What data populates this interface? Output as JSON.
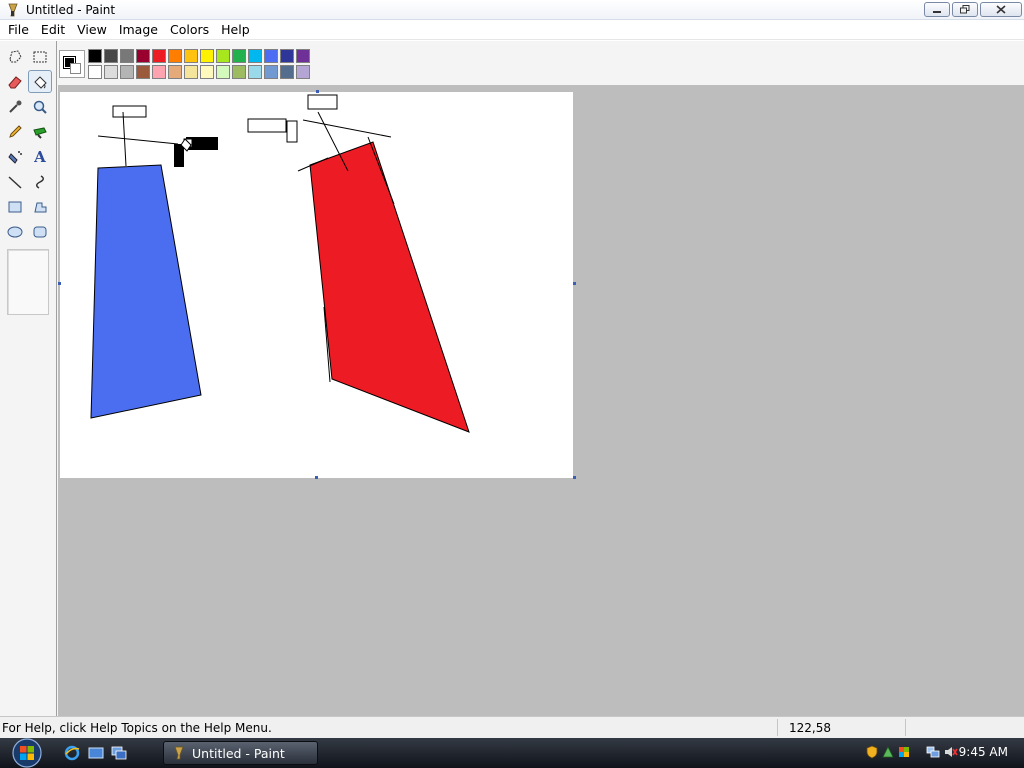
{
  "window": {
    "title": "Untitled - Paint"
  },
  "menu": [
    "File",
    "Edit",
    "View",
    "Image",
    "Colors",
    "Help"
  ],
  "tools": [
    {
      "name": "free-form-select-tool"
    },
    {
      "name": "select-tool"
    },
    {
      "name": "eraser-tool"
    },
    {
      "name": "fill-tool"
    },
    {
      "name": "pick-color-tool"
    },
    {
      "name": "magnifier-tool"
    },
    {
      "name": "pencil-tool"
    },
    {
      "name": "brush-tool"
    },
    {
      "name": "airbrush-tool"
    },
    {
      "name": "text-tool",
      "glyph": "A"
    },
    {
      "name": "line-tool"
    },
    {
      "name": "curve-tool"
    },
    {
      "name": "rectangle-tool"
    },
    {
      "name": "polygon-tool"
    },
    {
      "name": "ellipse-tool"
    },
    {
      "name": "rounded-rectangle-tool"
    }
  ],
  "palette": {
    "foreground": "#000000",
    "background": "#ffffff",
    "row1": [
      "#000000",
      "#464646",
      "#787878",
      "#990030",
      "#ed1c24",
      "#ff7e00",
      "#ffc20e",
      "#fff200",
      "#a8e61d",
      "#22b14c",
      "#00b7ef",
      "#4d6df3",
      "#2f3699",
      "#6f3198"
    ],
    "row2": [
      "#ffffff",
      "#dcdcdc",
      "#b4b4b4",
      "#9c5a3c",
      "#ffa3b1",
      "#e5aa7a",
      "#f5e49c",
      "#fff9bd",
      "#d3f9bc",
      "#9dbb61",
      "#99d9ea",
      "#709ad1",
      "#546d8e",
      "#b5a5d5"
    ]
  },
  "drawing": {
    "blue_fill": "#4b6ef1",
    "red_fill": "#ed1c24"
  },
  "status": {
    "help": "For Help, click Help Topics on the Help Menu.",
    "coords": "122,58"
  },
  "taskbar": {
    "task_label": "Untitled - Paint",
    "clock": "9:45 AM"
  }
}
